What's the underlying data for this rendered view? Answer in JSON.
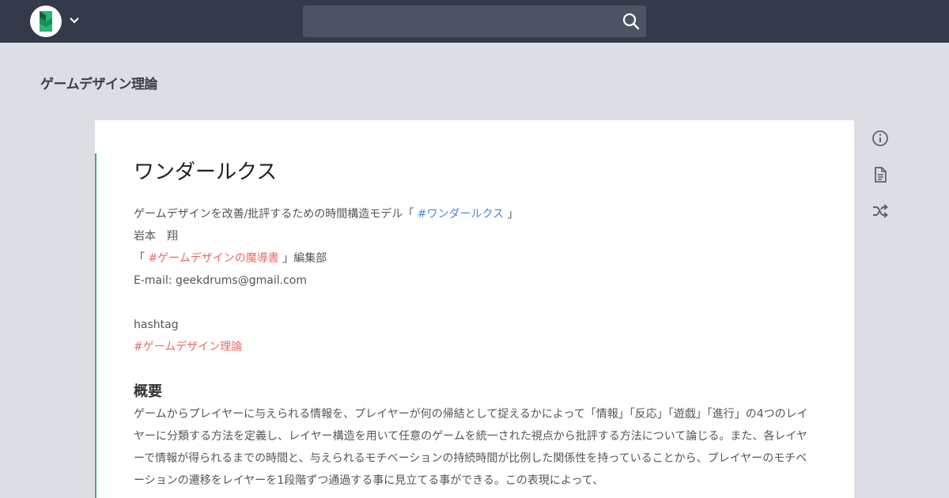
{
  "navbar": {
    "logo_icon": "scrapbox-logo-icon",
    "dropdown_icon": "chevron-down-icon",
    "search": {
      "value": "",
      "placeholder": ""
    },
    "search_icon": "search-icon"
  },
  "project": {
    "title": "ゲームデザイン理論"
  },
  "page": {
    "title": "ワンダールクス",
    "intro": {
      "prefix": "ゲームデザインを改善/批評するための時間構造モデル「 ",
      "link": "#ワンダールクス",
      "suffix": " 」"
    },
    "author": "岩本　翔",
    "publication": {
      "prefix": "「 ",
      "link": "#ゲームデザインの魔導書",
      "suffix": " 」編集部"
    },
    "email": "E-mail: geekdrums@gmail.com",
    "hashtag_label": "hashtag",
    "hashtag_link": "#ゲームデザイン理論",
    "section_heading": "概要",
    "summary": "ゲームからプレイヤーに与えられる情報を、プレイヤーが何の帰結として捉えるかによって「情報」「反応」「遊戯」「進行」の4つのレイヤーに分類する方法を定義し、レイヤー構造を用いて任意のゲームを統一された視点から批評する方法について論じる。また、各レイヤーで情報が得られるまでの時間と、与えられるモチベーションの持続時間が比例した関係性を持っていることから、プレイヤーのモチベーションの遷移をレイヤーを1段階ずつ通過する事に見立てる事ができる。この表現によって、"
  },
  "side_icons": [
    "info-icon",
    "page-text-icon",
    "shuffle-icon"
  ],
  "colors": {
    "navbar": "#343a4a",
    "background": "#dcdee3",
    "link_blue": "#4a8ad2",
    "link_red": "#ea6d63",
    "accent": "#4fa783"
  }
}
